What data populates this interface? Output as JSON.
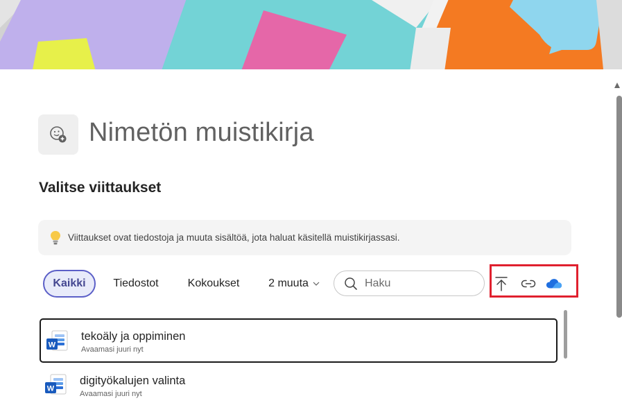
{
  "notebook": {
    "title": "Nimetön muistikirja",
    "icon": "notebook-add-icon"
  },
  "references": {
    "heading": "Valitse viittaukset",
    "info_text": "Viittaukset ovat tiedostoja ja muuta sisältöä, jota haluat käsitellä muistikirjassasi.",
    "info_icon": "lightbulb-icon"
  },
  "filters": {
    "tabs": [
      {
        "label": "Kaikki",
        "active": true
      },
      {
        "label": "Tiedostot",
        "active": false
      },
      {
        "label": "Kokoukset",
        "active": false
      },
      {
        "label": "2 muuta",
        "active": false
      }
    ]
  },
  "search": {
    "placeholder": "Haku",
    "value": ""
  },
  "actions": {
    "upload_icon": "upload-icon",
    "link_icon": "link-icon",
    "cloud_icon": "onedrive-cloud-icon",
    "accent_color": "#e0202e"
  },
  "items": [
    {
      "title": "tekoäly ja oppiminen",
      "subtitle": "Avaamasi juuri nyt",
      "icon": "word-document-icon"
    },
    {
      "title": "digityökalujen valinta",
      "subtitle": "Avaamasi juuri nyt",
      "icon": "word-document-icon"
    }
  ],
  "colors": {
    "active_tab_border": "#5b5fc7",
    "active_tab_bg": "#e8ebfa",
    "word_blue": "#185abd"
  }
}
